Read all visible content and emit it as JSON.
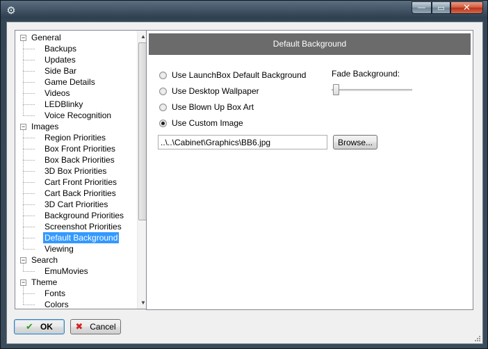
{
  "window": {
    "title": "",
    "icon": "gear-icon",
    "minimize_glyph": "—",
    "maximize_glyph": "▭",
    "close_glyph": "✕"
  },
  "tree": {
    "groups": [
      {
        "label": "General",
        "expander": "−",
        "children": [
          "Backups",
          "Updates",
          "Side Bar",
          "Game Details",
          "Videos",
          "LEDBlinky",
          "Voice Recognition"
        ]
      },
      {
        "label": "Images",
        "expander": "−",
        "children": [
          "Region Priorities",
          "Box Front Priorities",
          "Box Back Priorities",
          "3D Box Priorities",
          "Cart Front Priorities",
          "Cart Back Priorities",
          "3D Cart Priorities",
          "Background Priorities",
          "Screenshot Priorities",
          "Default Background",
          "Viewing"
        ]
      },
      {
        "label": "Search",
        "expander": "−",
        "children": [
          "EmuMovies"
        ]
      },
      {
        "label": "Theme",
        "expander": "−",
        "children": [
          "Fonts",
          "Colors"
        ]
      }
    ],
    "selected": "Default Background",
    "scroll_up_glyph": "▲",
    "scroll_down_glyph": "▼"
  },
  "panel": {
    "header": "Default Background",
    "options": [
      {
        "label": "Use LaunchBox Default Background",
        "checked": false
      },
      {
        "label": "Use Desktop Wallpaper",
        "checked": false
      },
      {
        "label": "Use Blown Up Box Art",
        "checked": false
      },
      {
        "label": "Use Custom Image",
        "checked": true
      }
    ],
    "fade_label": "Fade Background:",
    "fade_value": 0,
    "path_value": "..\\..\\Cabinet\\Graphics\\BB6.jpg",
    "browse_label": "Browse..."
  },
  "footer": {
    "ok_label": "OK",
    "ok_icon": "✔",
    "cancel_label": "Cancel",
    "cancel_icon": "✖"
  },
  "colors": {
    "selection": "#3399ff",
    "header_bg": "#6b6b6b",
    "ok_icon": "#2e9b1f",
    "cancel_icon": "#d42020"
  }
}
